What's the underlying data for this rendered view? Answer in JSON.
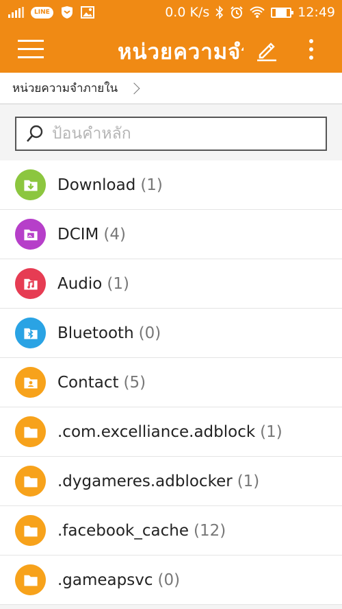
{
  "status_bar": {
    "carrier_badge": "LINE",
    "speed": "0.0 K/s",
    "time": "12:49",
    "battery_level_percent": 60,
    "icons": [
      "signal-icon",
      "line-app-icon",
      "shield-app-icon",
      "gallery-icon",
      "bluetooth-icon",
      "alarm-icon",
      "wifi-icon",
      "battery-icon"
    ]
  },
  "app_bar": {
    "title": "หน่วยความจำ",
    "menu_icon": "hamburger-menu-icon",
    "edit_icon": "pencil-icon",
    "more_icon": "more-vertical-icon"
  },
  "breadcrumb": {
    "path": "หน่วยความจำภายใน"
  },
  "search": {
    "placeholder": "ป้อนคำหลัก",
    "value": ""
  },
  "colors": {
    "accent": "#f08a14",
    "download": "#8cc63f",
    "dcim": "#b63fc9",
    "audio": "#e63c53",
    "bluetooth": "#2aa3e4",
    "folder": "#f7a21b"
  },
  "folders": [
    {
      "name": "Download",
      "count": "(1)",
      "icon": "download-folder-icon",
      "color": "#8cc63f"
    },
    {
      "name": "DCIM",
      "count": "(4)",
      "icon": "image-folder-icon",
      "color": "#b63fc9"
    },
    {
      "name": "Audio",
      "count": "(1)",
      "icon": "music-folder-icon",
      "color": "#e63c53"
    },
    {
      "name": "Bluetooth",
      "count": "(0)",
      "icon": "bluetooth-folder-icon",
      "color": "#2aa3e4"
    },
    {
      "name": "Contact",
      "count": "(5)",
      "icon": "contact-folder-icon",
      "color": "#f7a21b"
    },
    {
      "name": ".com.excelliance.adblock",
      "count": "(1)",
      "icon": "folder-icon",
      "color": "#f7a21b"
    },
    {
      "name": ".dygameres.adblocker",
      "count": "(1)",
      "icon": "folder-icon",
      "color": "#f7a21b"
    },
    {
      "name": ".facebook_cache",
      "count": "(12)",
      "icon": "folder-icon",
      "color": "#f7a21b"
    },
    {
      "name": ".gameapsvc",
      "count": "(0)",
      "icon": "folder-icon",
      "color": "#f7a21b"
    }
  ]
}
